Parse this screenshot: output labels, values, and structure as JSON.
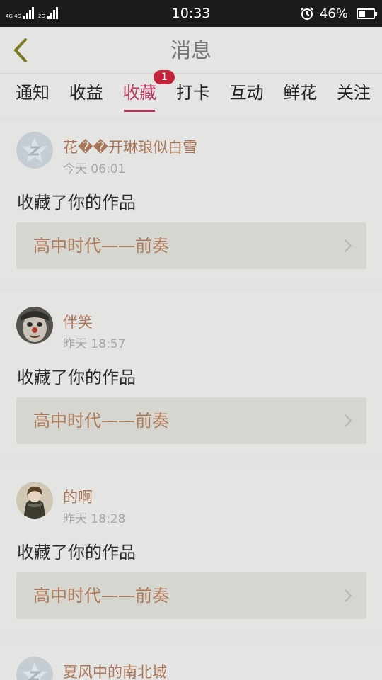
{
  "status_bar": {
    "network_top": "4G 4G",
    "network_bottom": "2G",
    "time": "10:33",
    "battery_text": "46%",
    "battery_level": 0.46
  },
  "header": {
    "title": "消息",
    "back_icon": "chevron-left-icon",
    "accent_color": "#b5385e"
  },
  "tabs": [
    {
      "label": "通知"
    },
    {
      "label": "收益"
    },
    {
      "label": "收藏",
      "badge": "1",
      "active": true
    },
    {
      "label": "打卡"
    },
    {
      "label": "互动"
    },
    {
      "label": "鲜花"
    },
    {
      "label": "关注"
    }
  ],
  "messages": [
    {
      "user": "花��开琳琅似白雪",
      "time": "今天 06:01",
      "action": "收藏了你的作品",
      "work": "高中时代——前奏",
      "avatar": "default-avatar-icon"
    },
    {
      "user": "伴笑",
      "time": "昨天 18:57",
      "action": "收藏了你的作品",
      "work": "高中时代——前奏",
      "avatar": "clown-avatar"
    },
    {
      "user": "的啊",
      "time": "昨天 18:28",
      "action": "收藏了你的作品",
      "work": "高中时代——前奏",
      "avatar": "girl-avatar"
    },
    {
      "user": "夏风中的南北城",
      "avatar": "default-avatar-icon"
    }
  ]
}
